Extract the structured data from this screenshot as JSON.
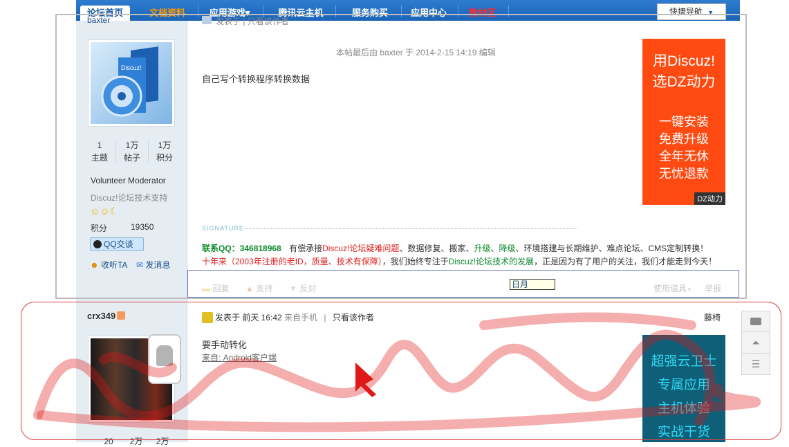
{
  "nav": {
    "items": [
      {
        "label": "论坛首页",
        "color": "#1a57a3",
        "active": true
      },
      {
        "label": "文档资料",
        "color": "#ff9900"
      },
      {
        "label": "应用游戏▾",
        "color": "#ffffff"
      },
      {
        "label": "腾讯云主机",
        "color": "#ffffff"
      },
      {
        "label": "服务购买",
        "color": "#ffffff"
      },
      {
        "label": "应用中心",
        "color": "#ffffff"
      },
      {
        "label": "教材区",
        "color": "#ff2b2b"
      }
    ],
    "quick_nav": "快捷导航"
  },
  "post1": {
    "author_partial": "baxter",
    "header_partial": "发表于 | 只看该作者",
    "edit_note": "本帖最后由 baxter 于 2014-2-15 14:19 编辑",
    "content": "自己写个转换程序转换数据",
    "stats": [
      {
        "value": "1",
        "label": "主题"
      },
      {
        "value": "1万",
        "label": "帖子"
      },
      {
        "value": "1万",
        "label": "积分"
      }
    ],
    "group": "Volunteer Moderator",
    "title": "Discuz!论坛技术支持",
    "points_label": "积分",
    "points_value": "19350",
    "qq_button": "QQ交谈",
    "follow": "收听TA",
    "message": "发消息",
    "signature_label": "SIGNATURE",
    "sig_line1_prefix": "联系QQ：346818968",
    "sig_line1_mid1": "有偿承接",
    "sig_line1_red": "Discuz!论坛疑难问题",
    "sig_line1_mid2": "、数据修复、搬家、",
    "sig_line1_green1": "升级",
    "sig_line1_mid3": "、",
    "sig_line1_green2": "降级",
    "sig_line1_rest": "、环境搭建与长期维护、难点论坛、CMS定制转换！",
    "sig_line2_red": "十年来（2003年注册的老ID，质量、技术有保障）",
    "sig_line2_mid": "，我们始终专注于",
    "sig_line2_green": "Discuz!论坛技术的发展",
    "sig_line2_rest": "，正是因为有了用户的关注，我们才能走到今天！",
    "actions": {
      "reply": "回复",
      "support": "支持",
      "oppose": "反对",
      "tools": "使用道具",
      "report": "举报"
    },
    "month_input": "日月",
    "ad_lines": [
      "用Discuz!",
      "选DZ动力",
      "一键安装",
      "免费升级",
      "全年无休",
      "无忧退款"
    ],
    "ad_tag": "DZ动力"
  },
  "post2": {
    "author": "crx349",
    "posted": "发表于 前天 16:42",
    "from_mobile": "来自手机",
    "only_author": "只看该作者",
    "floor": "藤椅",
    "content": "要手动转化",
    "source": "来自: Android客户端",
    "stats": [
      "20",
      "2万",
      "2万"
    ],
    "ad_lines": [
      "超强云卫士",
      "专属应用",
      "主机体验",
      "实战干货"
    ]
  },
  "colors": {
    "nav_bg": "#1b64b8",
    "left_bg": "#e5edf2",
    "annotation": "#d94040",
    "ad1": "#ff4a12",
    "ad2": "#0f5f78"
  }
}
